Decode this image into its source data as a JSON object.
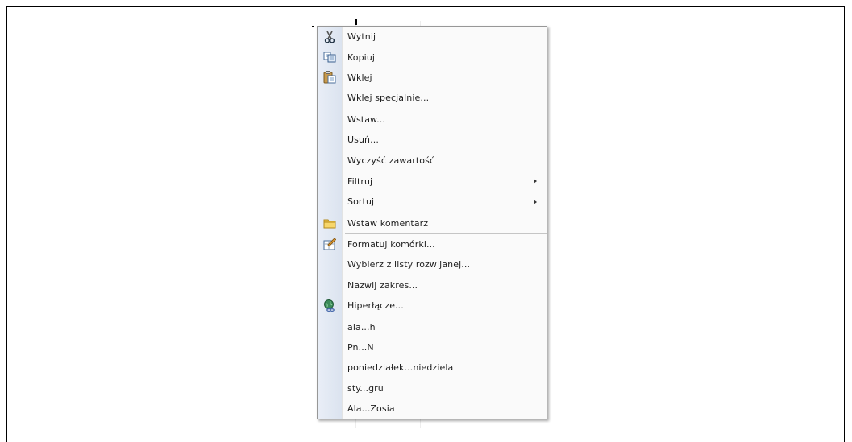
{
  "context_menu": {
    "items": [
      {
        "label": "Wytnij",
        "icon": "scissors-icon"
      },
      {
        "label": "Kopiuj",
        "icon": "copy-icon"
      },
      {
        "label": "Wklej",
        "icon": "paste-icon"
      },
      {
        "label": "Wklej specjalnie..."
      },
      {
        "label": "Wstaw..."
      },
      {
        "label": "Usuń..."
      },
      {
        "label": "Wyczyść zawartość"
      },
      {
        "label": "Filtruj",
        "submenu": true
      },
      {
        "label": "Sortuj",
        "submenu": true
      },
      {
        "label": "Wstaw komentarz",
        "icon": "comment-folder-icon"
      },
      {
        "label": "Formatuj komórki...",
        "icon": "format-cells-icon"
      },
      {
        "label": "Wybierz z listy rozwijanej..."
      },
      {
        "label": "Nazwij zakres..."
      },
      {
        "label": "Hiperłącze...",
        "icon": "hyperlink-globe-icon"
      },
      {
        "label": "ala...h"
      },
      {
        "label": "Pn...N"
      },
      {
        "label": "poniedziałek...niedziela"
      },
      {
        "label": "sty...gru"
      },
      {
        "label": "Ala...Zosia"
      }
    ]
  }
}
